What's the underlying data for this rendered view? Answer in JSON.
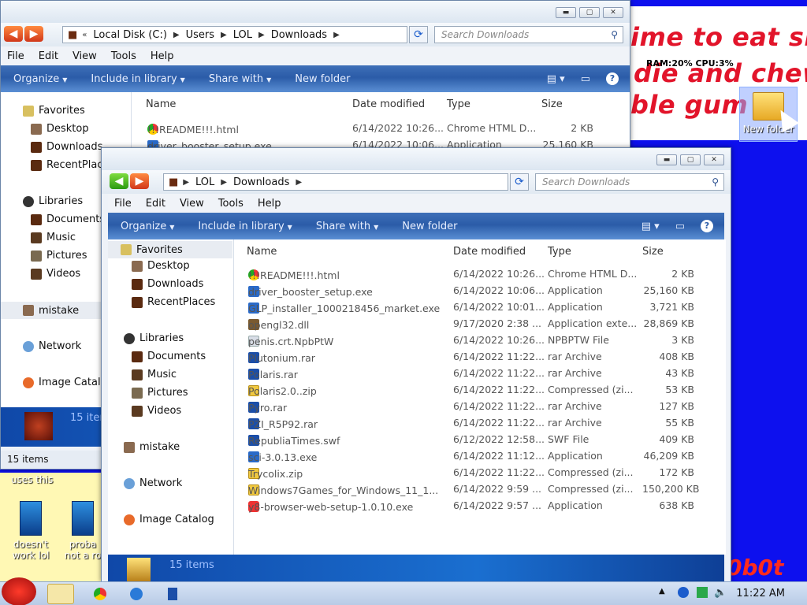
{
  "desktop": {
    "banner_lines": [
      "ime to eat shit",
      "die and chew",
      "ble gum"
    ],
    "stats": "RAM:20%  CPU:3%",
    "new_folder_label": "New folder",
    "left_banner_text": "uses this",
    "left_icons": [
      "doesn't work lol",
      "proba not a ro"
    ],
    "watermark": "0b0t"
  },
  "back_window": {
    "address": {
      "root": "Local Disk (C:)",
      "crumbs": [
        "Users",
        "LOL",
        "Downloads"
      ]
    },
    "search_placeholder": "Search Downloads",
    "menu": [
      "File",
      "Edit",
      "View",
      "Tools",
      "Help"
    ],
    "commands": [
      "Organize",
      "Include in library",
      "Share with",
      "New folder"
    ],
    "nav": {
      "favorites": "Favorites",
      "favorite_items": [
        "Desktop",
        "Downloads",
        "RecentPlaces"
      ],
      "libraries": "Libraries",
      "library_items": [
        "Documents",
        "Music",
        "Pictures",
        "Videos"
      ],
      "mistake": "mistake",
      "network": "Network",
      "image_catalog": "Image Catalog"
    },
    "columns": [
      "Name",
      "Date modified",
      "Type",
      "Size"
    ],
    "rows": [
      {
        "name": "!!!README!!!.html",
        "date": "6/14/2022 10:26...",
        "type": "Chrome HTML D...",
        "size": "2 KB"
      },
      {
        "name": "driver_booster_setup.exe",
        "date": "6/14/2022 10:06...",
        "type": "Application",
        "size": "25,160 KB"
      }
    ],
    "details_count": "15 items",
    "status": "15 items"
  },
  "front_window": {
    "address": {
      "crumbs": [
        "LOL",
        "Downloads"
      ]
    },
    "search_placeholder": "Search Downloads",
    "menu": [
      "File",
      "Edit",
      "View",
      "Tools",
      "Help"
    ],
    "commands": [
      "Organize",
      "Include in library",
      "Share with",
      "New folder"
    ],
    "nav": {
      "favorites": "Favorites",
      "favorite_items": [
        "Desktop",
        "Downloads",
        "RecentPlaces"
      ],
      "libraries": "Libraries",
      "library_items": [
        "Documents",
        "Music",
        "Pictures",
        "Videos"
      ],
      "mistake": "mistake",
      "network": "Network",
      "image_catalog": "Image Catalog"
    },
    "columns": [
      "Name",
      "Date modified",
      "Type",
      "Size"
    ],
    "rows": [
      {
        "name": "!!!README!!!.html",
        "date": "6/14/2022 10:26...",
        "type": "Chrome HTML D...",
        "size": "2 KB",
        "icon": "chrome-icon"
      },
      {
        "name": "driver_booster_setup.exe",
        "date": "6/14/2022 10:06...",
        "type": "Application",
        "size": "25,160 KB",
        "icon": "app-icon"
      },
      {
        "name": "GLP_installer_1000218456_market.exe",
        "date": "6/14/2022 10:01...",
        "type": "Application",
        "size": "3,721 KB",
        "icon": "app-icon"
      },
      {
        "name": "opengl32.dll",
        "date": "9/17/2020 2:38 ...",
        "type": "Application exte...",
        "size": "28,869 KB",
        "icon": "dll-icon"
      },
      {
        "name": "penis.crt.NpbPtW",
        "date": "6/14/2022 10:26...",
        "type": "NPBPTW File",
        "size": "3 KB",
        "icon": "file-icon"
      },
      {
        "name": "Plutonium.rar",
        "date": "6/14/2022 11:22...",
        "type": "rar Archive",
        "size": "408 KB",
        "icon": "archive-icon"
      },
      {
        "name": "Polaris.rar",
        "date": "6/14/2022 11:22...",
        "type": "rar Archive",
        "size": "43 KB",
        "icon": "archive-icon"
      },
      {
        "name": "Polaris2.0..zip",
        "date": "6/14/2022 11:22...",
        "type": "Compressed (zi...",
        "size": "53 KB",
        "icon": "zip-icon"
      },
      {
        "name": "Pyro.rar",
        "date": "6/14/2022 11:22...",
        "type": "rar Archive",
        "size": "127 KB",
        "icon": "archive-icon"
      },
      {
        "name": "PZI_R5P92.rar",
        "date": "6/14/2022 11:22...",
        "type": "rar Archive",
        "size": "55 KB",
        "icon": "archive-icon"
      },
      {
        "name": "RepubliaTimes.swf",
        "date": "6/12/2022 12:58...",
        "type": "SWF File",
        "size": "409 KB",
        "icon": "archive-icon"
      },
      {
        "name": "sci-3.0.13.exe",
        "date": "6/14/2022 11:12...",
        "type": "Application",
        "size": "46,209 KB",
        "icon": "app-icon"
      },
      {
        "name": "Trycolix.zip",
        "date": "6/14/2022 11:22...",
        "type": "Compressed (zi...",
        "size": "172 KB",
        "icon": "zip-icon"
      },
      {
        "name": "Windows7Games_for_Windows_11_1...",
        "date": "6/14/2022 9:59 ...",
        "type": "Compressed (zi...",
        "size": "150,200 KB",
        "icon": "zip-icon"
      },
      {
        "name": "y8-browser-web-setup-1.0.10.exe",
        "date": "6/14/2022 9:57 ...",
        "type": "Application",
        "size": "638 KB",
        "icon": "y8-icon"
      }
    ],
    "details_count": "15 items"
  },
  "taskbar": {
    "clock": "11:22 AM"
  },
  "colors": {
    "wallpaper": "#0d10ee",
    "cmdbar": "#2b5ca8",
    "accent_red": "#e2142a"
  }
}
